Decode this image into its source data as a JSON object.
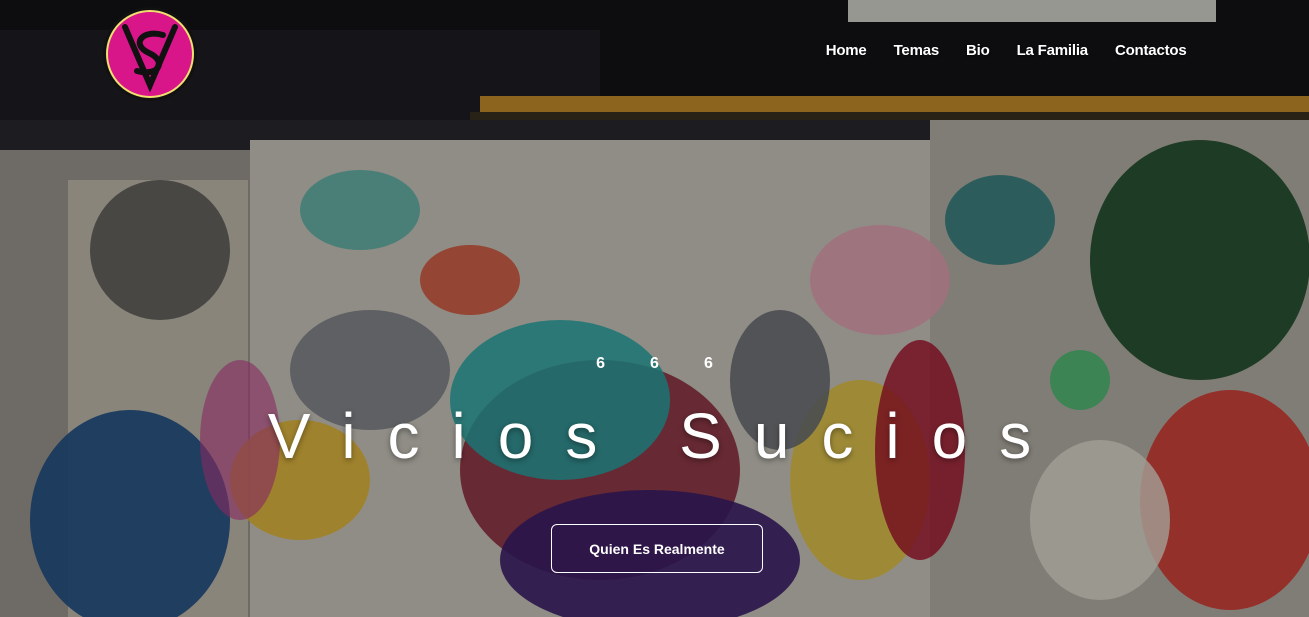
{
  "brand": {
    "logo": "vs-monogram-logo",
    "accent": "#d9158a"
  },
  "nav": {
    "items": [
      {
        "label": "Home"
      },
      {
        "label": "Temas"
      },
      {
        "label": "Bio"
      },
      {
        "label": "La Familia"
      },
      {
        "label": "Contactos"
      }
    ]
  },
  "hero": {
    "eyebrow": "666",
    "title": "Vicios Sucios",
    "cta_label": "Quien Es Realmente",
    "background": "graffiti-wall-image"
  }
}
